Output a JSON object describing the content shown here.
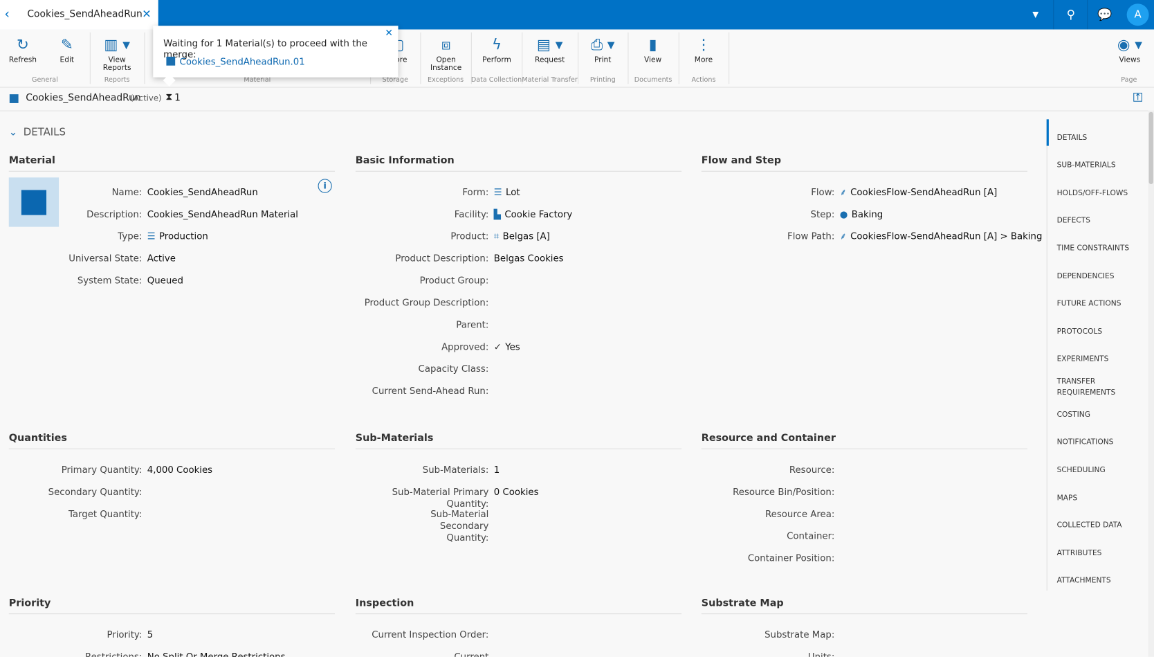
{
  "tab": {
    "title": "Cookies_SendAheadRun"
  },
  "toolbar": {
    "buttons": [
      {
        "label": "Refresh",
        "icon": "↻",
        "name": "refresh"
      },
      {
        "label": "Edit",
        "icon": "✎",
        "name": "edit"
      },
      {
        "label": "View Reports",
        "icon": "▥ ▾",
        "name": "view-reports"
      },
      {
        "label": "Store",
        "icon": "▢",
        "name": "store"
      },
      {
        "label": "Open Instance",
        "icon": "⧈",
        "name": "open-instance"
      },
      {
        "label": "Perform",
        "icon": "ϟ",
        "name": "perform"
      },
      {
        "label": "Request",
        "icon": "▤ ▾",
        "name": "request"
      },
      {
        "label": "Print",
        "icon": "⎙ ▾",
        "name": "print"
      },
      {
        "label": "View",
        "icon": "▮",
        "name": "view"
      },
      {
        "label": "More",
        "icon": "⋮",
        "name": "more"
      },
      {
        "label": "Views",
        "icon": "◉ ▾",
        "name": "views"
      }
    ],
    "groups": [
      "General",
      "Reports",
      "Material",
      "Storage",
      "Exceptions",
      "Data Collection",
      "Material Transfer",
      "Printing",
      "Documents",
      "Actions",
      "Page"
    ]
  },
  "popup": {
    "message": "Waiting for 1 Material(s) to proceed with the merge:",
    "link": "Cookies_SendAheadRun.01"
  },
  "entity": {
    "name": "Cookies_SendAheadRun",
    "state": "(Active)",
    "count": "1"
  },
  "details": {
    "title": "DETAILS"
  },
  "sections": [
    {
      "title": "Material",
      "rows": [
        [
          "Name:",
          "Cookies_SendAheadRun",
          ""
        ],
        [
          "Description:",
          "Cookies_SendAheadRun Material",
          ""
        ],
        [
          "Type:",
          "Production",
          "☰"
        ],
        [
          "Universal State:",
          "Active",
          ""
        ],
        [
          "System State:",
          "Queued",
          ""
        ]
      ]
    },
    {
      "title": "Basic Information",
      "rows": [
        [
          "Form:",
          "Lot",
          "☰"
        ],
        [
          "Facility:",
          "Cookie Factory",
          "▙"
        ],
        [
          "Product:",
          "Belgas [A]",
          "⌗"
        ],
        [
          "Product Description:",
          "Belgas Cookies",
          ""
        ],
        [
          "Product Group:",
          "",
          ""
        ],
        [
          "Product Group Description:",
          "",
          ""
        ],
        [
          "Parent:",
          "",
          ""
        ],
        [
          "Approved:",
          "Yes",
          "✓"
        ],
        [
          "Capacity Class:",
          "",
          ""
        ],
        [
          "Current Send-Ahead Run:",
          "",
          ""
        ]
      ]
    },
    {
      "title": "Flow and Step",
      "rows": [
        [
          "Flow:",
          "CookiesFlow-SendAheadRun [A]",
          "⸙"
        ],
        [
          "Step:",
          "Baking",
          "●"
        ],
        [
          "Flow Path:",
          "CookiesFlow-SendAheadRun [A] > Baking",
          "⸙"
        ]
      ]
    },
    {
      "title": "Quantities",
      "rows": [
        [
          "Primary Quantity:",
          "4,000  Cookies",
          ""
        ],
        [
          "Secondary Quantity:",
          "",
          ""
        ],
        [
          "Target Quantity:",
          "",
          ""
        ]
      ]
    },
    {
      "title": "Sub-Materials",
      "rows": [
        [
          "Sub-Materials:",
          "1",
          ""
        ],
        [
          "Sub-Material Primary Quantity:",
          "0 Cookies",
          ""
        ],
        [
          "Sub-Material Secondary Quantity:",
          "",
          ""
        ]
      ]
    },
    {
      "title": "Resource and Container",
      "rows": [
        [
          "Resource:",
          "",
          ""
        ],
        [
          "Resource Bin/Position:",
          "",
          ""
        ],
        [
          "Resource Area:",
          "",
          ""
        ],
        [
          "Container:",
          "",
          ""
        ],
        [
          "Container Position:",
          "",
          ""
        ]
      ]
    },
    {
      "title": "Priority",
      "rows": [
        [
          "Priority:",
          "5",
          ""
        ],
        [
          "Restrictions:",
          "No Split Or Merge Restrictions",
          ""
        ]
      ]
    },
    {
      "title": "Inspection",
      "rows": [
        [
          "Current Inspection Order:",
          "",
          ""
        ],
        [
          "Current Inspection Order Step",
          "",
          ""
        ]
      ]
    },
    {
      "title": "Substrate Map",
      "rows": [
        [
          "Substrate Map:",
          "",
          ""
        ],
        [
          "Units:",
          "",
          ""
        ]
      ]
    }
  ],
  "nav": [
    "DETAILS",
    "SUB-MATERIALS",
    "HOLDS/OFF-FLOWS",
    "DEFECTS",
    "TIME CONSTRAINTS",
    "DEPENDENCIES",
    "FUTURE ACTIONS",
    "PROTOCOLS",
    "EXPERIMENTS",
    "TRANSFER REQUIREMENTS",
    "COSTING",
    "NOTIFICATIONS",
    "SCHEDULING",
    "MAPS",
    "COLLECTED DATA",
    "ATTRIBUTES",
    "ATTACHMENTS"
  ],
  "user": {
    "initial": "A"
  }
}
